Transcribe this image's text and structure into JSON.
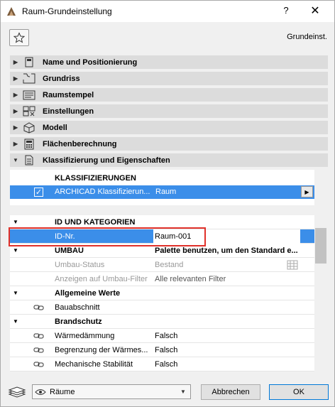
{
  "window": {
    "title": "Raum-Grundeinstellung",
    "help": "?",
    "close": "✕"
  },
  "header": {
    "preset_name": "Grundeinst."
  },
  "sections": [
    {
      "label": "Name und Positionierung",
      "icon": "id-card-icon",
      "expanded": false
    },
    {
      "label": "Grundriss",
      "icon": "floorplan-icon",
      "expanded": false
    },
    {
      "label": "Raumstempel",
      "icon": "stamp-icon",
      "expanded": false
    },
    {
      "label": "Einstellungen",
      "icon": "settings-grid-icon",
      "expanded": false
    },
    {
      "label": "Modell",
      "icon": "cube-icon",
      "expanded": false
    },
    {
      "label": "Flächenberechnung",
      "icon": "calculator-icon",
      "expanded": false
    },
    {
      "label": "Klassifizierung und Eigenschaften",
      "icon": "document-icon",
      "expanded": true
    }
  ],
  "classifications": {
    "header": "KLASSIFIZIERUNGEN",
    "row": {
      "system": "ARCHICAD Klassifizierun...",
      "value": "Raum",
      "checked": true
    }
  },
  "properties": [
    {
      "type": "group",
      "label": "ID UND KATEGORIEN",
      "value": ""
    },
    {
      "type": "selected",
      "label": "ID-Nr.",
      "value": "Raum-001"
    },
    {
      "type": "group",
      "label": "UMBAU",
      "value": "Palette benutzen, um den Standard e..."
    },
    {
      "type": "grey",
      "label": "Umbau-Status",
      "value": "Bestand"
    },
    {
      "type": "grey",
      "label": "Anzeigen auf Umbau-Filter",
      "value": "Alle relevanten Filter"
    },
    {
      "type": "group",
      "label": "Allgemeine Werte",
      "value": ""
    },
    {
      "type": "linked",
      "label": "Bauabschnitt",
      "value": ""
    },
    {
      "type": "group",
      "label": "Brandschutz",
      "value": ""
    },
    {
      "type": "linked",
      "label": "Wärmedämmung",
      "value": "Falsch"
    },
    {
      "type": "linked",
      "label": "Begrenzung der Wärmes...",
      "value": "Falsch"
    },
    {
      "type": "linked",
      "label": "Mechanische Stabilität",
      "value": "Falsch"
    }
  ],
  "footer": {
    "view_select": "Räume",
    "cancel_label": "Abbrechen",
    "ok_label": "OK"
  },
  "colors": {
    "selection": "#3b8ee9",
    "highlight": "#e0312a"
  }
}
